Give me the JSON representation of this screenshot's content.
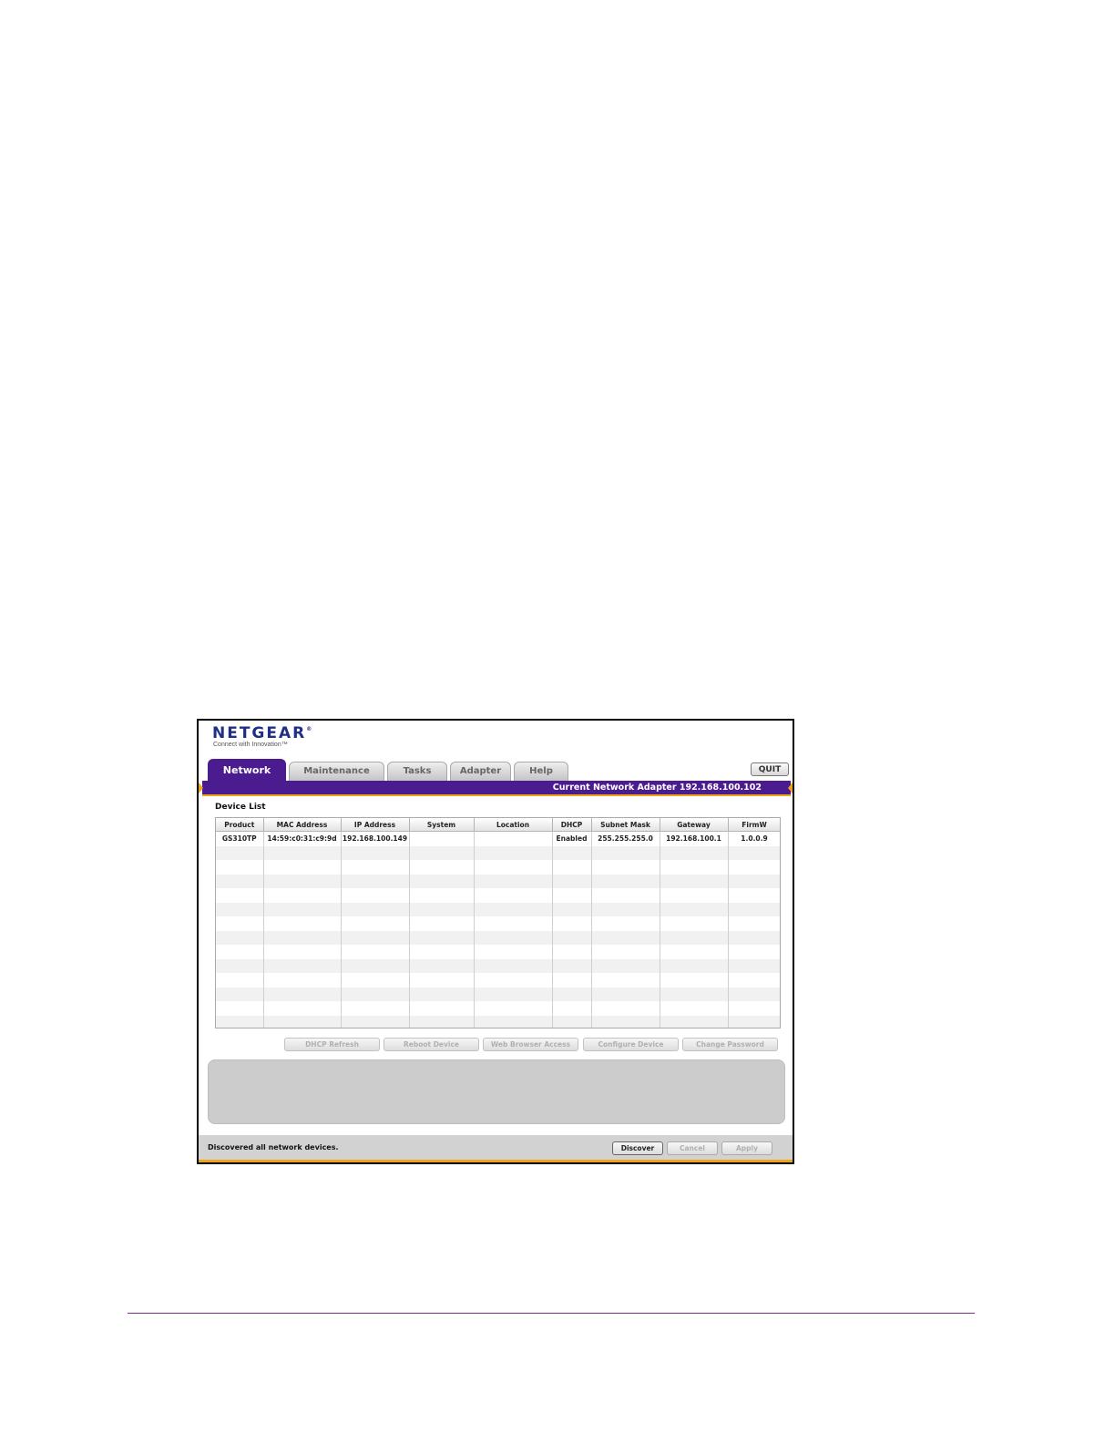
{
  "app": {
    "logo_text": "NETGEAR",
    "logo_mark": "®",
    "tagline": "Connect with Innovation™"
  },
  "tabs": [
    {
      "label": "Network",
      "active": true
    },
    {
      "label": "Maintenance",
      "active": false
    },
    {
      "label": "Tasks",
      "active": false
    },
    {
      "label": "Adapter",
      "active": false
    },
    {
      "label": "Help",
      "active": false
    }
  ],
  "quit_label": "QUIT",
  "adapter_bar": {
    "label": "Current Network Adapter 192.168.100.102"
  },
  "device_list": {
    "title": "Device List",
    "columns": [
      "Product",
      "MAC Address",
      "IP Address",
      "System",
      "Location",
      "DHCP",
      "Subnet Mask",
      "Gateway",
      "FirmW"
    ],
    "rows": [
      [
        "GS310TP",
        "14:59:c0:31:c9:9d",
        "192.168.100.149",
        "",
        "",
        "Enabled",
        "255.255.255.0",
        "192.168.100.1",
        "1.0.0.9"
      ]
    ]
  },
  "actions": [
    "DHCP Refresh",
    "Reboot Device",
    "Web Browser Access",
    "Configure Device",
    "Change Password"
  ],
  "status": {
    "text": "Discovered all network devices.",
    "buttons": [
      {
        "label": "Discover",
        "enabled": true
      },
      {
        "label": "Cancel",
        "enabled": false
      },
      {
        "label": "Apply",
        "enabled": false
      }
    ]
  },
  "colors": {
    "brand": "#4b1c90",
    "accent": "#f0a21c",
    "logo": "#1f2f86"
  }
}
